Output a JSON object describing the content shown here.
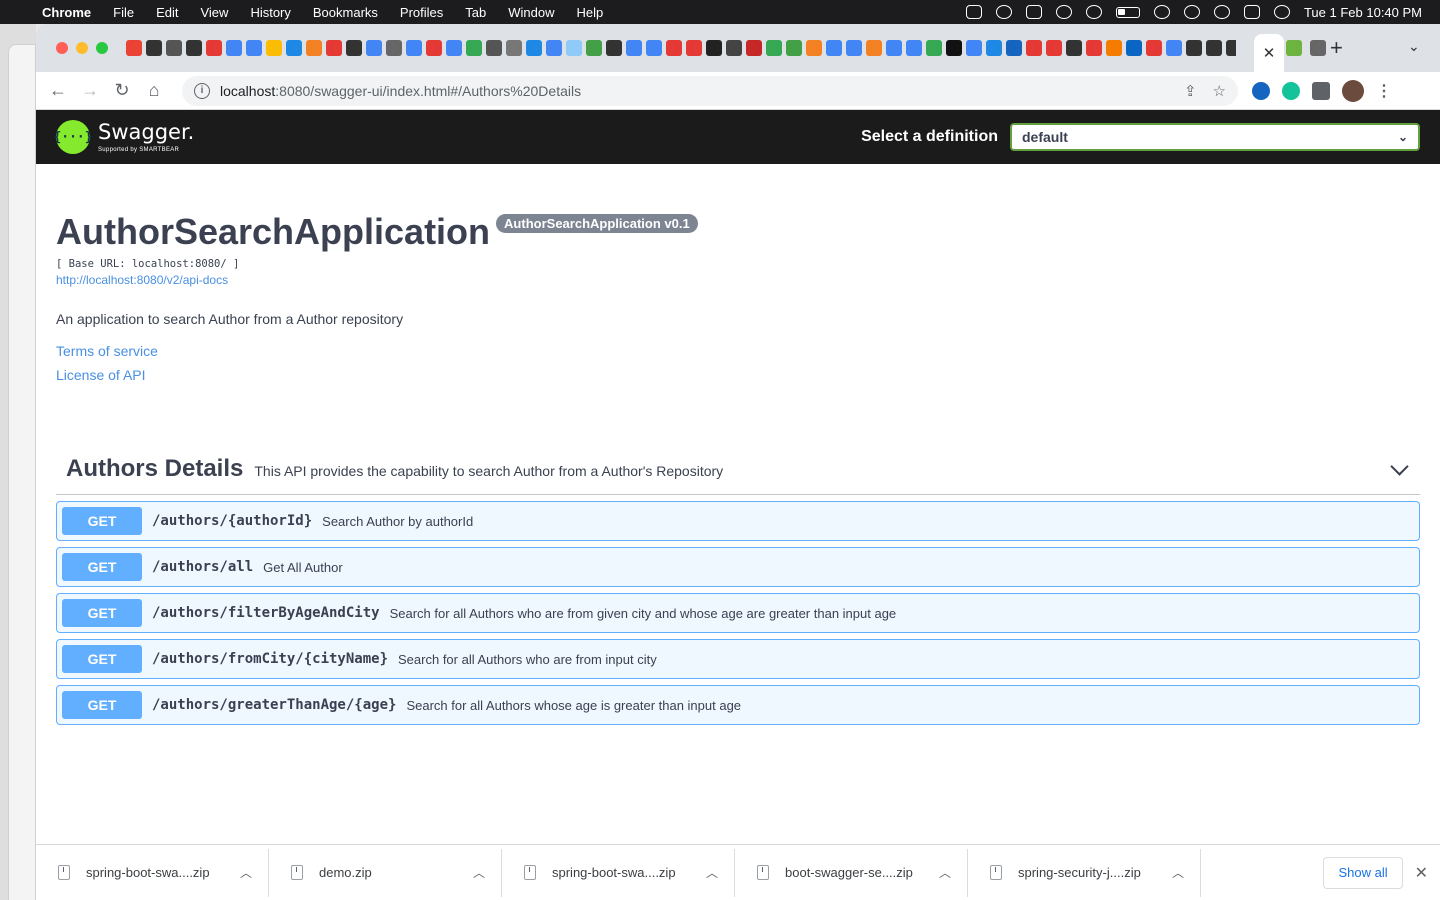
{
  "menubar": {
    "apple": "",
    "items": [
      "Chrome",
      "File",
      "Edit",
      "View",
      "History",
      "Bookmarks",
      "Profiles",
      "Tab",
      "Window",
      "Help"
    ],
    "clock": "Tue 1 Feb  10:40 PM"
  },
  "browser": {
    "tab_close": "✕",
    "new_tab": "+",
    "tab_search": "⌄",
    "url_host": "localhost",
    "url_path": ":8080/swagger-ui/index.html#/Authors%20Details",
    "info": "i"
  },
  "swagger": {
    "logo_mark": "{···}",
    "logo_name": "Swagger.",
    "logo_sub": "Supported by SMARTBEAR",
    "definition_label": "Select a definition",
    "definition_value": "default"
  },
  "info": {
    "title": "AuthorSearchApplication",
    "version_badge": "AuthorSearchApplication v0.1",
    "base_url": "[ Base URL: localhost:8080/ ]",
    "spec_link": "http://localhost:8080/v2/api-docs",
    "description": "An application to search Author from a Author repository",
    "terms": "Terms of service",
    "license": "License of API"
  },
  "tag": {
    "name": "Authors Details",
    "description": "This API provides the capability to search Author from a Author's Repository"
  },
  "operations": [
    {
      "method": "GET",
      "path": "/authors/{authorId}",
      "summary": "Search Author by authorId"
    },
    {
      "method": "GET",
      "path": "/authors/all",
      "summary": "Get All Author"
    },
    {
      "method": "GET",
      "path": "/authors/filterByAgeAndCity",
      "summary": "Search for all Authors who are from given city and whose age are greater than input age"
    },
    {
      "method": "GET",
      "path": "/authors/fromCity/{cityName}",
      "summary": "Search for all Authors who are from input city"
    },
    {
      "method": "GET",
      "path": "/authors/greaterThanAge/{age}",
      "summary": "Search for all Authors whose age is greater than input age"
    }
  ],
  "downloads": {
    "items": [
      "spring-boot-swa....zip",
      "demo.zip",
      "spring-boot-swa....zip",
      "boot-swagger-se....zip",
      "spring-security-j....zip"
    ],
    "show_all": "Show all"
  },
  "colors": {
    "get": "#61affe",
    "swagger_green": "#85ea2d",
    "link": "#4990e2"
  }
}
